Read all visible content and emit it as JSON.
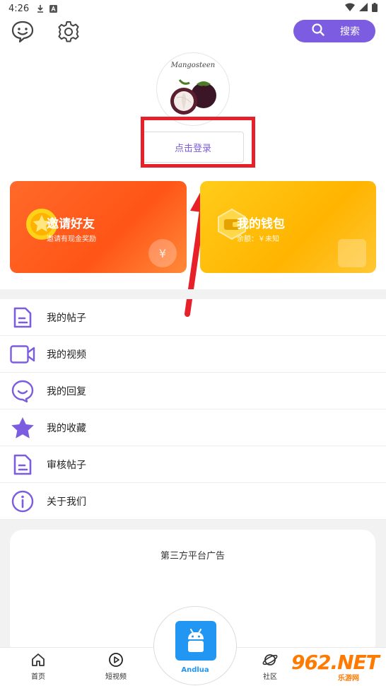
{
  "status_bar": {
    "time": "4:26"
  },
  "header": {
    "search_label": "搜索"
  },
  "profile": {
    "avatar_brand": "Mangosteen",
    "login_label": "点击登录"
  },
  "cards": {
    "invite": {
      "title": "邀请好友",
      "subtitle": "邀请有现金奖励",
      "deco": "¥"
    },
    "wallet": {
      "title": "我的钱包",
      "subtitle": "余额：￥未知"
    }
  },
  "menu": {
    "items": [
      {
        "label": "我的帖子",
        "icon": "post-icon"
      },
      {
        "label": "我的视频",
        "icon": "video-icon"
      },
      {
        "label": "我的回复",
        "icon": "reply-icon"
      },
      {
        "label": "我的收藏",
        "icon": "star-icon"
      },
      {
        "label": "审核帖子",
        "icon": "review-icon"
      },
      {
        "label": "关于我们",
        "icon": "info-icon"
      }
    ]
  },
  "ad": {
    "title": "第三方平台广告"
  },
  "bottom_nav": {
    "home": "首页",
    "short_video": "短视频",
    "center_app": "Andlua",
    "community": "社区"
  },
  "watermark": {
    "big": "962.NET",
    "small": "乐游网"
  },
  "colors": {
    "accent": "#7c5ce0",
    "invite": "#ff5a1f",
    "wallet": "#ffb400",
    "highlight": "#e8202a"
  }
}
